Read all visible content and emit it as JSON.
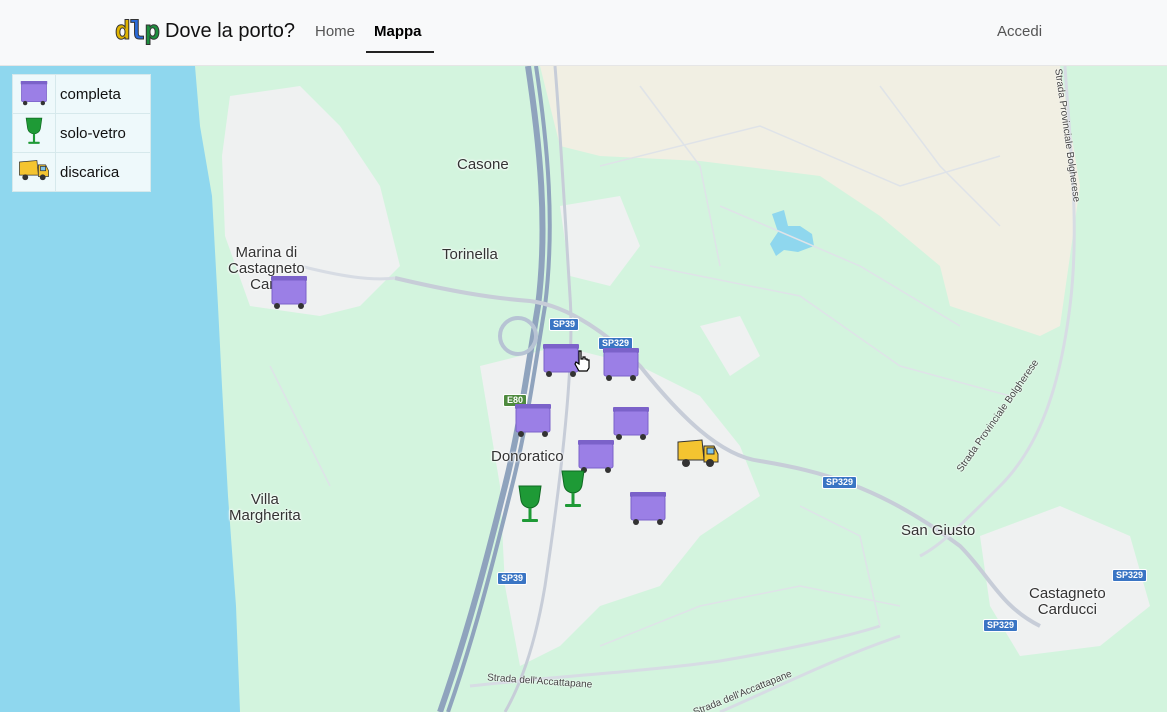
{
  "brand": {
    "logo_d": "d",
    "logo_l": "l",
    "logo_p": "p",
    "name": "Dove la porto?"
  },
  "nav": {
    "home": "Home",
    "map": "Mappa",
    "login": "Accedi"
  },
  "legend": [
    {
      "icon": "dumpster-icon",
      "label": "completa"
    },
    {
      "icon": "wine-glass-icon",
      "label": "solo-vetro"
    },
    {
      "icon": "garbage-truck-icon",
      "label": "discarica"
    }
  ],
  "places": {
    "casone": "Casone",
    "torinella": "Torinella",
    "marina": "Marina di\nCastagneto\nCard",
    "donoratico": "Donoratico",
    "villa": "Villa\nMargherita",
    "san_giusto": "San Giusto",
    "castagneto": "Castagneto\nCarducci"
  },
  "shields": {
    "sp39": "SP39",
    "sp329": "SP329",
    "e80": "E80"
  },
  "roads": {
    "accattapane": "Strada dell'Accattapane",
    "bolgherese": "Strada Provinciale Bolgherese"
  },
  "colors": {
    "sea": "#8fd7ee",
    "land": "#d3f4de",
    "urban": "#f0f1f3",
    "marker": "#9b7fe6",
    "glass": "#1e9a36",
    "truck": "#f4c430"
  }
}
